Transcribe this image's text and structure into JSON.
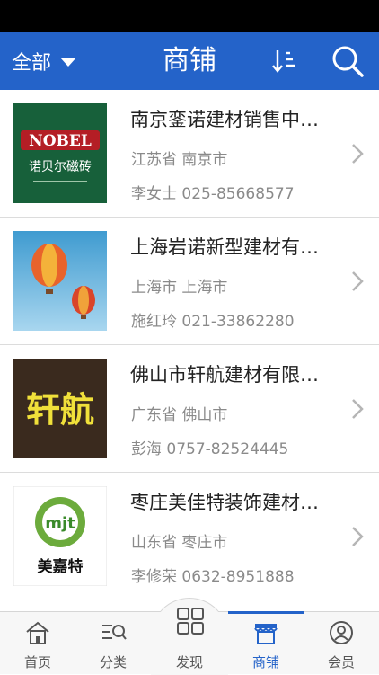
{
  "header": {
    "filter_label": "全部",
    "title": "商铺",
    "sort_icon": "sort-icon",
    "search_icon": "search-icon",
    "color": "#2463c9"
  },
  "shops": [
    {
      "name": "南京銮诺建材销售中…",
      "location": "江苏省 南京市",
      "contact": "李女士 025-85668577",
      "logo_text": "诺贝尔磁砖"
    },
    {
      "name": "上海岩诺新型建材有…",
      "location": "上海市 上海市",
      "contact": "施红玲 021-33862280"
    },
    {
      "name": "佛山市轩航建材有限…",
      "location": "广东省 佛山市",
      "contact": "彭海 0757-82524445",
      "logo_text": "轩航"
    },
    {
      "name": "枣庄美佳特装饰建材…",
      "location": "山东省 枣庄市",
      "contact": "李修荣 0632-8951888",
      "logo_text": "美嘉特"
    }
  ],
  "tabs": [
    {
      "label": "首页",
      "icon": "home-icon"
    },
    {
      "label": "分类",
      "icon": "category-icon"
    },
    {
      "label": "发现",
      "icon": "discover-icon"
    },
    {
      "label": "商铺",
      "icon": "shop-icon",
      "active": true
    },
    {
      "label": "会员",
      "icon": "user-icon"
    }
  ]
}
